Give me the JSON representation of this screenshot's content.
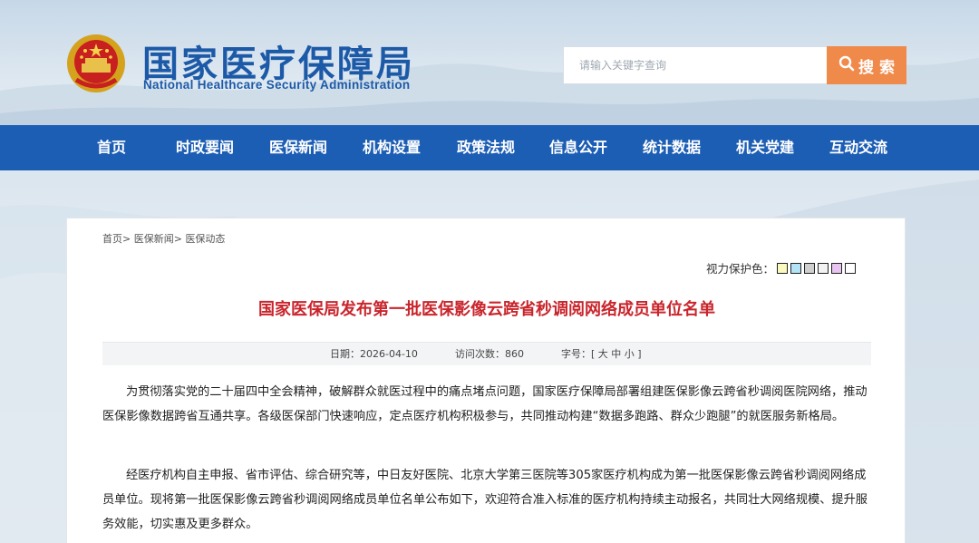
{
  "header": {
    "title": "国家医疗保障局",
    "subtitle": "National Healthcare Security Administration",
    "search_placeholder": "请输入关键字查询",
    "search_button": "搜 索"
  },
  "nav": {
    "items": [
      "首页",
      "时政要闻",
      "医保新闻",
      "机构设置",
      "政策法规",
      "信息公开",
      "统计数据",
      "机关党建",
      "互动交流"
    ]
  },
  "breadcrumb": {
    "items": [
      "首页",
      "医保新闻",
      "医保动态"
    ],
    "separator": ">"
  },
  "eye_care": {
    "label": "视力保护色：",
    "swatches": [
      "#fafabe",
      "#b3e3f5",
      "#cfcfcf",
      "#f2f2f2",
      "#e8c4f0",
      "#ffffff"
    ]
  },
  "article": {
    "title": "国家医保局发布第一批医保影像云跨省秒调阅网络成员单位名单",
    "date_label": "日期：",
    "date": "2026-04-10",
    "visits_label": "访问次数：",
    "visits": "860",
    "fontsize_label": "字号：",
    "fontsize_open": "[",
    "fontsize_large": "大",
    "fontsize_medium": "中",
    "fontsize_small": "小",
    "fontsize_close": "]",
    "paragraphs": [
      "为贯彻落实党的二十届四中全会精神，破解群众就医过程中的痛点堵点问题，国家医疗保障局部署组建医保影像云跨省秒调阅医院网络，推动医保影像数据跨省互通共享。各级医保部门快速响应，定点医疗机构积极参与，共同推动构建“数据多跑路、群众少跑腿”的就医服务新格局。",
      "经医疗机构自主申报、省市评估、综合研究等，中日友好医院、北京大学第三医院等305家医疗机构成为第一批医保影像云跨省秒调阅网络成员单位。现将第一批医保影像云跨省秒调阅网络成员单位名单公布如下，欢迎符合准入标准的医疗机构持续主动报名，共同壮大网络规模、提升服务效能，切实惠及更多群众。"
    ]
  },
  "colors": {
    "brand_blue": "#1d5eb5",
    "title_red": "#c9252c",
    "search_orange": "#f08a4b"
  }
}
